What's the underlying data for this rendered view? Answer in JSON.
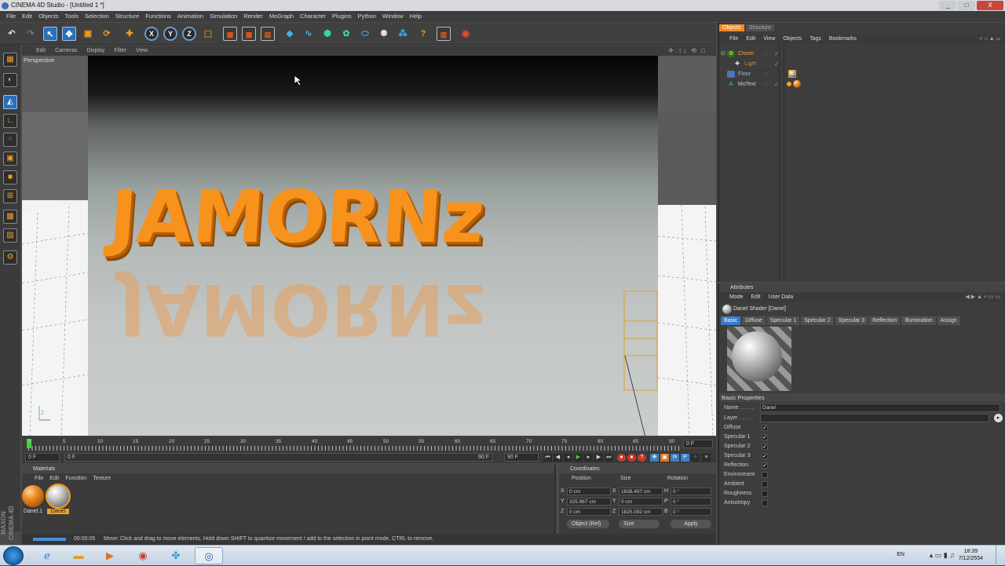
{
  "window": {
    "title": "CINEMA 4D Studio - [Untitled 1 *]",
    "controls": [
      "_",
      "□",
      "X"
    ]
  },
  "menubar": [
    "File",
    "Edit",
    "Objects",
    "Tools",
    "Selection",
    "Structure",
    "Functions",
    "Animation",
    "Simulation",
    "Render",
    "MoGraph",
    "Character",
    "Plugins",
    "Python",
    "Window",
    "Help"
  ],
  "viewport": {
    "menu": [
      "Edit",
      "Cameras",
      "Display",
      "Filter",
      "View"
    ],
    "label": "Perspective",
    "scene_text": "JAMORNz",
    "axis_label": "Z",
    "nav_icons": "✛ ↑↓ ⟲ □"
  },
  "timeline": {
    "ticks": [
      "0",
      "5",
      "10",
      "15",
      "20",
      "25",
      "30",
      "35",
      "40",
      "45",
      "50",
      "55",
      "60",
      "65",
      "70",
      "75",
      "80",
      "85",
      "90"
    ],
    "current_frame": "0 F"
  },
  "transport": {
    "start": "0 F",
    "range_start": "0 F",
    "range_end": "90 F",
    "end": "90 F"
  },
  "materials": {
    "title": "Materials",
    "menu": [
      "File",
      "Edit",
      "Function",
      "Texture"
    ],
    "items": [
      {
        "name": "Danel.1",
        "color": "#f08a20"
      },
      {
        "name": "Danel",
        "color": "#bdbdbd",
        "selected": true
      }
    ]
  },
  "coordinates": {
    "title": "Coordinates",
    "headers": [
      "Position",
      "Size",
      "Rotation"
    ],
    "rows": [
      {
        "axis": "X",
        "pos": "0 cm",
        "saxis": "X",
        "size": "1838.497 cm",
        "raxis": "H",
        "rot": "0 °"
      },
      {
        "axis": "Y",
        "pos": "325.967 cm",
        "saxis": "Y",
        "size": "0 cm",
        "raxis": "P",
        "rot": "0 °"
      },
      {
        "axis": "Z",
        "pos": "0 cm",
        "saxis": "Z",
        "size": "1825.092 cm",
        "raxis": "B",
        "rot": "0 °"
      }
    ],
    "mode": "Object (Rel)",
    "size_mode": "Size",
    "apply": "Apply"
  },
  "status": {
    "time": "00:00:05",
    "message": "Move: Click and drag to move elements. Hold down SHIFT to quantize movement / add to the selection in point mode, CTRL to remove."
  },
  "branding": "MAXON CINEMA 4D",
  "object_manager": {
    "tabs": [
      "Objects",
      "Structure"
    ],
    "menu": [
      "File",
      "Edit",
      "View",
      "Objects",
      "Tags",
      "Bookmarks"
    ],
    "objects": [
      {
        "name": "Cloner",
        "color": "#f0a020"
      },
      {
        "name": "Light",
        "color": "#d08a30"
      },
      {
        "name": "Floor",
        "color": "#9ab8e0"
      },
      {
        "name": "MoText",
        "color": "#cccccc"
      }
    ]
  },
  "attributes": {
    "title": "Attributes",
    "menu": [
      "Mode",
      "Edit",
      "User Data"
    ],
    "shader": "Danel Shader [Danel]",
    "tabs": [
      "Basic",
      "Diffuse",
      "Specular 1",
      "Specular 2",
      "Specular 3",
      "Reflection",
      "Illumination",
      "Assign"
    ],
    "section": "Basic Properties",
    "name_label": "Name . . . . .",
    "name_value": "Danel",
    "layer_label": "Layer . . . . .",
    "props": [
      {
        "label": "Diffuse",
        "checked": "✓"
      },
      {
        "label": "Specular 1",
        "checked": "✓"
      },
      {
        "label": "Specular 2",
        "checked": "✓"
      },
      {
        "label": "Specular 3",
        "checked": "✓"
      },
      {
        "label": "Reflection",
        "checked": "✓"
      },
      {
        "label": "Environment",
        "checked": ""
      },
      {
        "label": "Ambient",
        "checked": ""
      },
      {
        "label": "Roughness",
        "checked": ""
      },
      {
        "label": "Anisotropy",
        "checked": ""
      }
    ]
  },
  "taskbar": {
    "lang": "EN",
    "time": "18:39",
    "date": "7/12/2554"
  }
}
